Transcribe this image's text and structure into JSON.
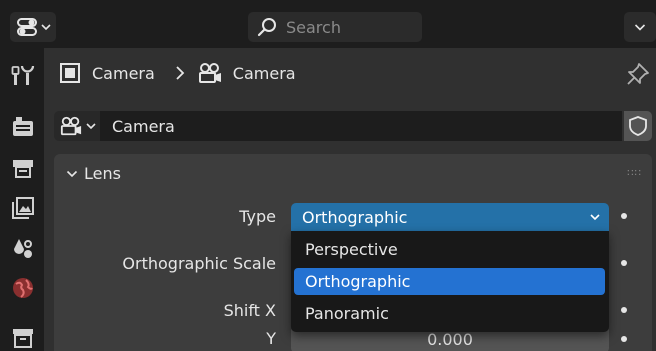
{
  "header": {
    "search_placeholder": "Search"
  },
  "breadcrumb": {
    "object_label": "Camera",
    "data_label": "Camera"
  },
  "datablock": {
    "name": "Camera"
  },
  "panel": {
    "title": "Lens"
  },
  "properties": {
    "type_label": "Type",
    "type_value": "Orthographic",
    "ortho_scale_label": "Orthographic Scale",
    "shift_x_label": "Shift X",
    "y_label": "Y",
    "y_value": "0.000"
  },
  "dropdown": {
    "options": [
      "Perspective",
      "Orthographic",
      "Panoramic"
    ],
    "selected": "Orthographic"
  },
  "colors": {
    "accent": "#2472d2",
    "select_bg": "#2471a8",
    "world_icon": "#c94b4b"
  }
}
